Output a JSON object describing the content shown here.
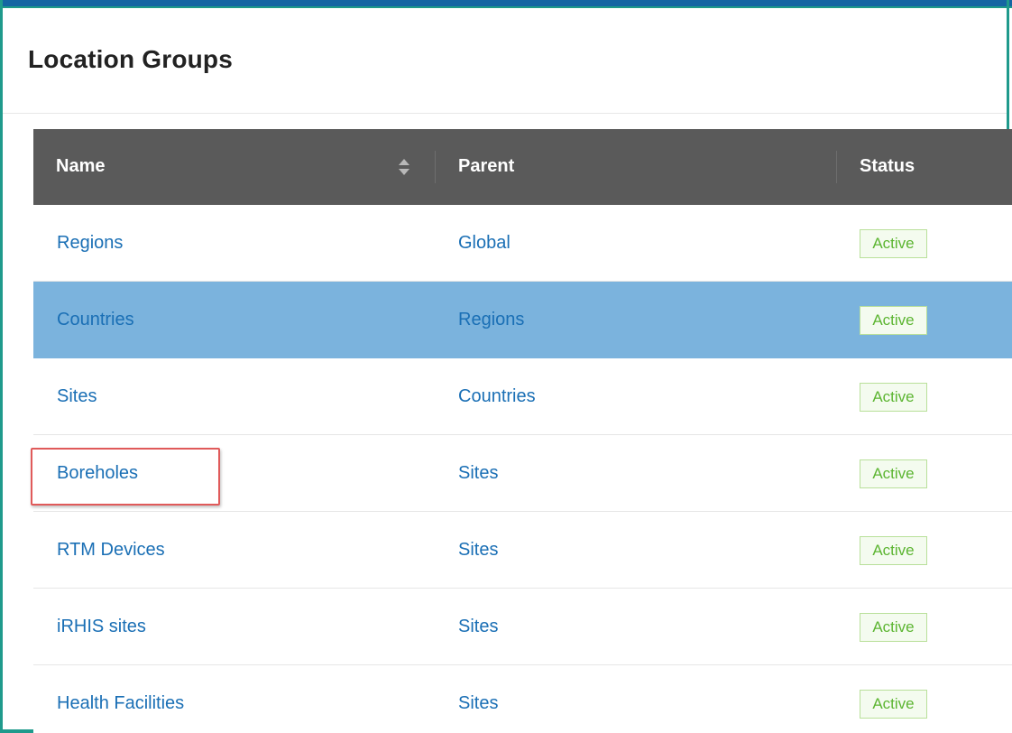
{
  "page": {
    "title": "Location Groups"
  },
  "colors": {
    "header_bg": "#5a5a5a",
    "link": "#1a6fb5",
    "selected_row": "#7bb3dd",
    "badge_text": "#5cb531",
    "badge_border": "#b9e09a",
    "frame": "#1f9a8c",
    "highlight": "#e05a5a"
  },
  "table": {
    "columns": [
      "Name",
      "Parent",
      "Status"
    ],
    "sort_icon": "sort-updown-icon",
    "rows": [
      {
        "name": "Regions",
        "parent": "Global",
        "status": "Active"
      },
      {
        "name": "Countries",
        "parent": "Regions",
        "status": "Active",
        "selected": true
      },
      {
        "name": "Sites",
        "parent": "Countries",
        "status": "Active"
      },
      {
        "name": "Boreholes",
        "parent": "Sites",
        "status": "Active",
        "highlighted": true
      },
      {
        "name": "RTM Devices",
        "parent": "Sites",
        "status": "Active"
      },
      {
        "name": "iRHIS sites",
        "parent": "Sites",
        "status": "Active"
      },
      {
        "name": "Health Facilities",
        "parent": "Sites",
        "status": "Active"
      }
    ]
  }
}
